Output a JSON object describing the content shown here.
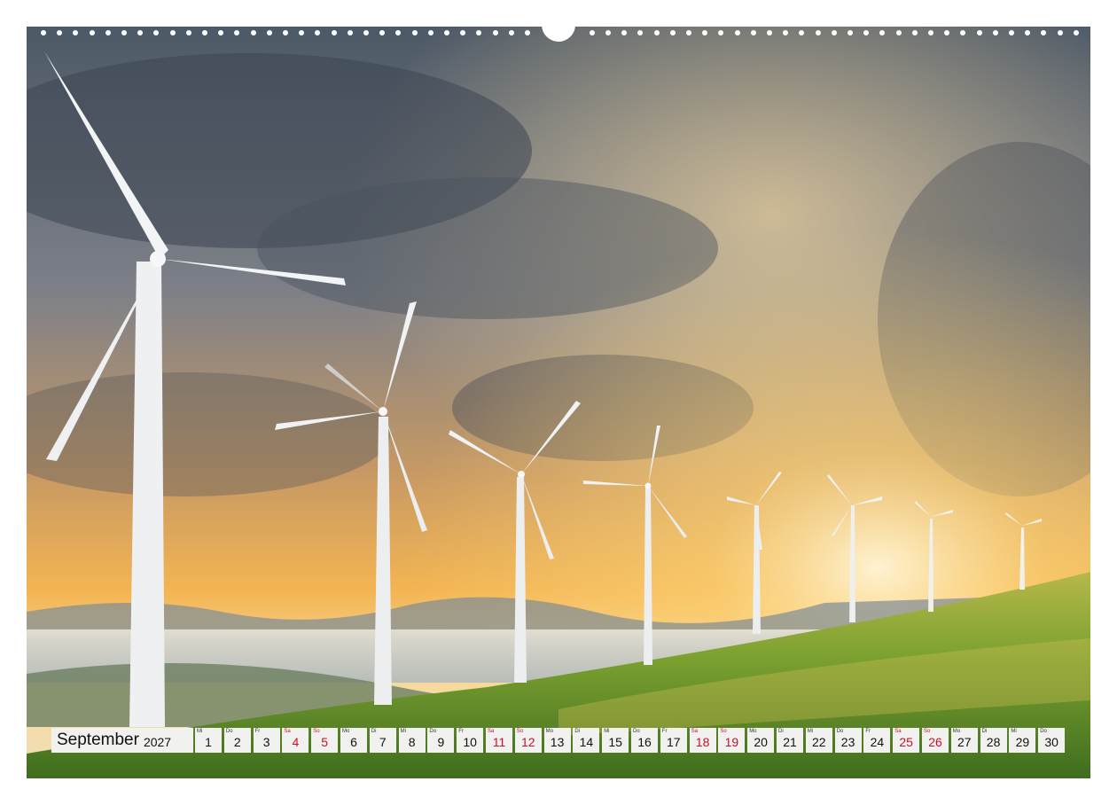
{
  "calendar": {
    "month": "September",
    "year": "2027",
    "days": [
      {
        "wd": "Mi",
        "num": "1",
        "weekend": false
      },
      {
        "wd": "Do",
        "num": "2",
        "weekend": false
      },
      {
        "wd": "Fr",
        "num": "3",
        "weekend": false
      },
      {
        "wd": "Sa",
        "num": "4",
        "weekend": true
      },
      {
        "wd": "So",
        "num": "5",
        "weekend": true
      },
      {
        "wd": "Mo",
        "num": "6",
        "weekend": false
      },
      {
        "wd": "Di",
        "num": "7",
        "weekend": false
      },
      {
        "wd": "Mi",
        "num": "8",
        "weekend": false
      },
      {
        "wd": "Do",
        "num": "9",
        "weekend": false
      },
      {
        "wd": "Fr",
        "num": "10",
        "weekend": false
      },
      {
        "wd": "Sa",
        "num": "11",
        "weekend": true
      },
      {
        "wd": "So",
        "num": "12",
        "weekend": true
      },
      {
        "wd": "Mo",
        "num": "13",
        "weekend": false
      },
      {
        "wd": "Di",
        "num": "14",
        "weekend": false
      },
      {
        "wd": "Mi",
        "num": "15",
        "weekend": false
      },
      {
        "wd": "Do",
        "num": "16",
        "weekend": false
      },
      {
        "wd": "Fr",
        "num": "17",
        "weekend": false
      },
      {
        "wd": "Sa",
        "num": "18",
        "weekend": true
      },
      {
        "wd": "So",
        "num": "19",
        "weekend": true
      },
      {
        "wd": "Mo",
        "num": "20",
        "weekend": false
      },
      {
        "wd": "Di",
        "num": "21",
        "weekend": false
      },
      {
        "wd": "Mi",
        "num": "22",
        "weekend": false
      },
      {
        "wd": "Do",
        "num": "23",
        "weekend": false
      },
      {
        "wd": "Fr",
        "num": "24",
        "weekend": false
      },
      {
        "wd": "Sa",
        "num": "25",
        "weekend": true
      },
      {
        "wd": "So",
        "num": "26",
        "weekend": true
      },
      {
        "wd": "Mo",
        "num": "27",
        "weekend": false
      },
      {
        "wd": "Di",
        "num": "28",
        "weekend": false
      },
      {
        "wd": "Mi",
        "num": "29",
        "weekend": false
      },
      {
        "wd": "Do",
        "num": "30",
        "weekend": false
      }
    ]
  },
  "colors": {
    "weekend": "#c8102e",
    "cell_bg": "#f1f1ef",
    "sky_top": "#5b6672",
    "sunset": "#f4b04a",
    "grass": "#6f9a2a"
  }
}
